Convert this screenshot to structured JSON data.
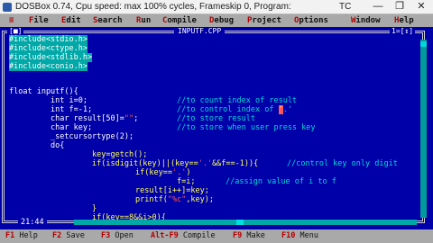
{
  "window": {
    "title": "DOSBox 0.74, Cpu speed: max 100% cycles, Frameskip  0, Program:",
    "program": "TC",
    "controls": [
      "—",
      "❐",
      "✕"
    ]
  },
  "menu": [
    {
      "hot": "≡",
      "rest": ""
    },
    {
      "hot": "F",
      "rest": "ile"
    },
    {
      "hot": "E",
      "rest": "dit"
    },
    {
      "hot": "S",
      "rest": "earch"
    },
    {
      "hot": "R",
      "rest": "un"
    },
    {
      "hot": "C",
      "rest": "ompile"
    },
    {
      "hot": "D",
      "rest": "ebug"
    },
    {
      "hot": "P",
      "rest": "roject"
    },
    {
      "hot": "O",
      "rest": "ptions"
    },
    {
      "hot": "W",
      "rest": "indow"
    },
    {
      "hot": "H",
      "rest": "elp"
    }
  ],
  "editor": {
    "filename": "INPUTF.CPP",
    "corner_left": "[■]",
    "corner_right": "1=[↕]",
    "includes": [
      "#include<stdio.h>",
      "#include<ctype.h>",
      "#include<stdlib.h>",
      "#include<conio.h>"
    ],
    "code": {
      "fn": "float inputf(){",
      "l1": "int i=0;",
      "l1c": "//to count index of result",
      "l2": "int f=-1;",
      "l2c_a": "//to control index of ",
      "l2c_cur": "'",
      "l2c_b": ".'",
      "l3a": "char result[50]=",
      "l3b": "\"\"",
      "l3c": ";",
      "l3cm": "//to store result",
      "l4": "char key;",
      "l4c": "//to store when user press key",
      "l5": "_setcursortype(2);",
      "l6": "do{",
      "l7": "key=getch();",
      "l8a": "if(isdigit(key)||(key==",
      "l8b": "'.'",
      "l8c": "&&f==-1)){",
      "l8cm": "//control key only digit",
      "l9a": "if(key==",
      "l9b": "'.'",
      "l9c": ")",
      "l10": "f=i;",
      "l10c": "//assign value of i to f",
      "l11": "result[i++]=key;",
      "l12a": "printf(",
      "l12b": "\"%c\"",
      "l12c": ",key);",
      "l13": "}",
      "l14": "if(key==8&&i>0){"
    },
    "cursor_pos": "21:44"
  },
  "keys": [
    {
      "key": "F1",
      "label": "Help"
    },
    {
      "key": "F2",
      "label": "Save"
    },
    {
      "key": "F3",
      "label": "Open"
    },
    {
      "key": "Alt-F9",
      "label": "Compile"
    },
    {
      "key": "F9",
      "label": "Make"
    },
    {
      "key": "F10",
      "label": "Menu"
    }
  ]
}
